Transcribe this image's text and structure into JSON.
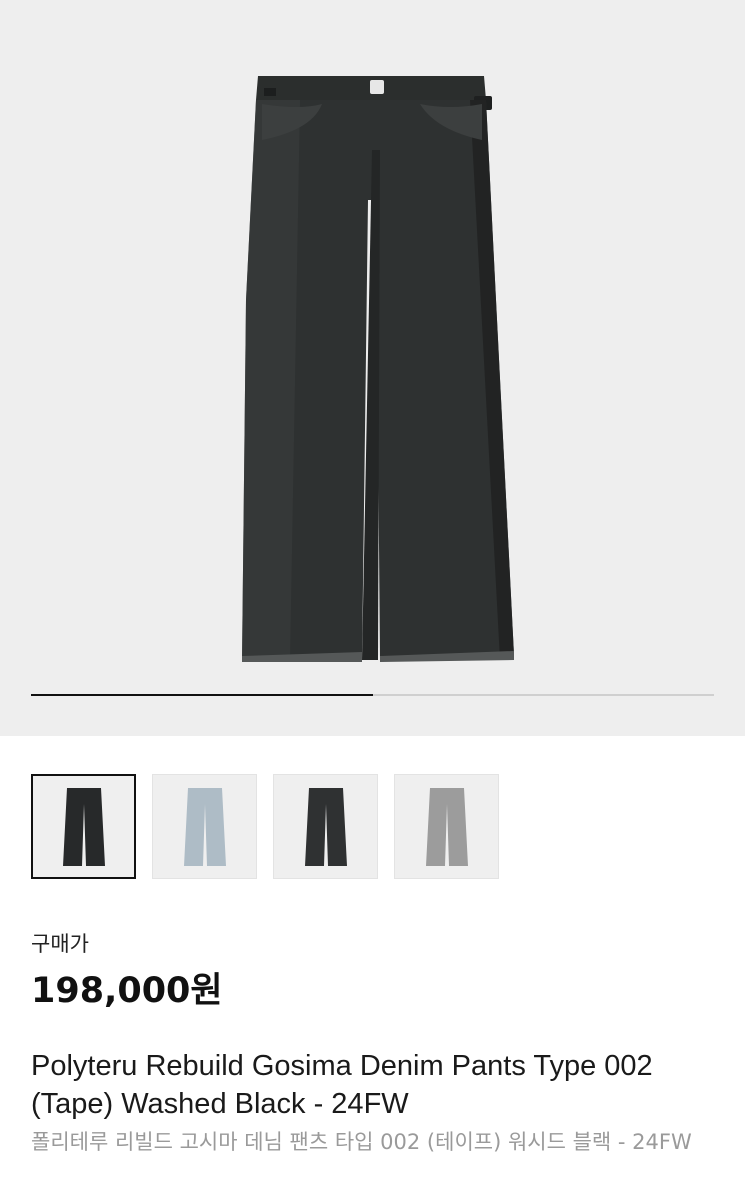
{
  "gallery": {
    "current_index": 1,
    "total_images": 2,
    "progress_fraction": 0.5,
    "main_image_icon": "wide-leg-denim-pants-washed-black",
    "main_color": "#2a2d2c"
  },
  "thumbnails": [
    {
      "icon": "pants-washed-black",
      "color": "#27292a",
      "selected": true
    },
    {
      "icon": "pants-light-blue",
      "color": "#aebcc6",
      "selected": false
    },
    {
      "icon": "pants-washed-black-alt",
      "color": "#2f3132",
      "selected": false
    },
    {
      "icon": "pants-gray",
      "color": "#9c9c9c",
      "selected": false
    }
  ],
  "product": {
    "price_label": "구매가",
    "price": "198,000원",
    "name_en": "Polyteru Rebuild Gosima Denim Pants Type 002 (Tape) Washed Black - 24FW",
    "name_ko": "폴리테루 리빌드 고시마 데님 팬츠 타입 002 (테이프) 워시드 블랙 - 24FW"
  }
}
